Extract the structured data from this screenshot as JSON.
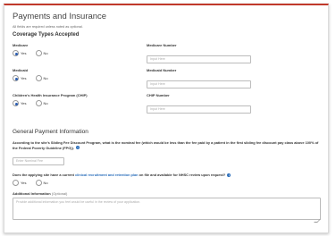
{
  "header": {
    "title": "Payments and Insurance",
    "required_note": "All fields are required unless noted as optional."
  },
  "coverage": {
    "heading": "Coverage Types Accepted",
    "medicare": {
      "label": "Medicare",
      "yes": "Yes",
      "no": "No",
      "selected": "Yes",
      "number_label": "Medicare Number",
      "number_placeholder": "Input Here"
    },
    "medicaid": {
      "label": "Medicaid",
      "yes": "Yes",
      "no": "No",
      "selected": "Yes",
      "number_label": "Medicaid Number",
      "number_placeholder": "Input Here"
    },
    "chip": {
      "label": "Children's Health Insurance Program (CHIP)",
      "yes": "Yes",
      "no": "No",
      "selected": "Yes",
      "number_label": "CHIP Number",
      "number_placeholder": "Input Here"
    }
  },
  "payment": {
    "heading": "General Payment Information",
    "fee_question": "According to the site's Sliding Fee Discount Program, what is the nominal fee (which would be less than the fee paid by a patient in the first sliding fee discount pay class above 100% of the Federal Poverty Guideline (FPG)).",
    "fee_placeholder": "Enter Nominal Fee",
    "plan_question_before": "Does the applying site have a current ",
    "plan_question_link": "clinical recruitment and retention plan",
    "plan_question_after": " on file and available for NHSC review upon request?",
    "plan_yes": "Yes",
    "plan_no": "No",
    "additional_label": "Additional Information",
    "additional_optional": "(Optional)",
    "additional_placeholder": "Provide additional information you feel would be useful in the review of your application."
  },
  "icons": {
    "info": "info-icon",
    "resize": "resize-grip-icon"
  },
  "colors": {
    "accent": "#c0392b",
    "link": "#2a6ebb",
    "radio_selected": "#2a5db0"
  }
}
